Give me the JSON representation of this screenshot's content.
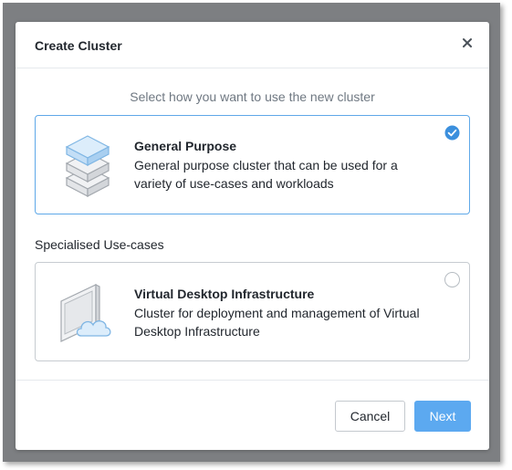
{
  "dialog": {
    "title": "Create Cluster",
    "close_icon": "close-icon",
    "subtitle": "Select how you want to use the new cluster"
  },
  "options": {
    "general": {
      "title": "General Purpose",
      "description": "General purpose cluster that can be used for a variety of use-cases and workloads",
      "icon": "server-stack-icon",
      "selected": true
    },
    "section_label": "Specialised Use-cases",
    "vdi": {
      "title": "Virtual Desktop Infrastructure",
      "description": "Cluster for deployment and management of Virtual Desktop Infrastructure",
      "icon": "desktop-cloud-icon",
      "selected": false
    }
  },
  "footer": {
    "cancel_label": "Cancel",
    "next_label": "Next"
  },
  "colors": {
    "accent": "#5ca9f0",
    "selected_border": "#5fa8e8",
    "overlay": "#7d7f82"
  }
}
